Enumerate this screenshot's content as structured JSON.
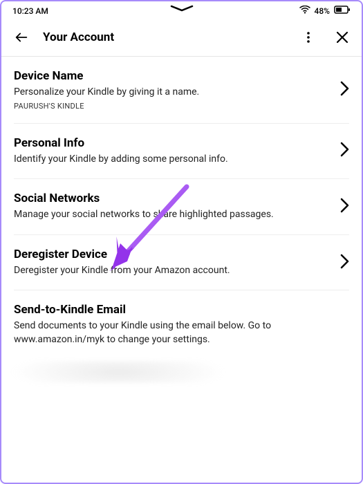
{
  "status": {
    "time": "10:23 AM",
    "battery_pct": "48%"
  },
  "header": {
    "title": "Your Account"
  },
  "items": [
    {
      "title": "Device Name",
      "desc": "Personalize your Kindle by giving it a name.",
      "sub": "PAURUSH'S KINDLE"
    },
    {
      "title": "Personal Info",
      "desc": "Identify your Kindle by adding some personal info."
    },
    {
      "title": "Social Networks",
      "desc": "Manage your social networks to share highlighted passages."
    },
    {
      "title": "Deregister Device",
      "desc": "Deregister your Kindle from your Amazon account."
    },
    {
      "title": "Send-to-Kindle Email",
      "desc": "Send documents to your Kindle using the email below. Go to www.amazon.in/myk to change your settings."
    }
  ],
  "annotation": {
    "arrow_color": "#9333ea"
  }
}
